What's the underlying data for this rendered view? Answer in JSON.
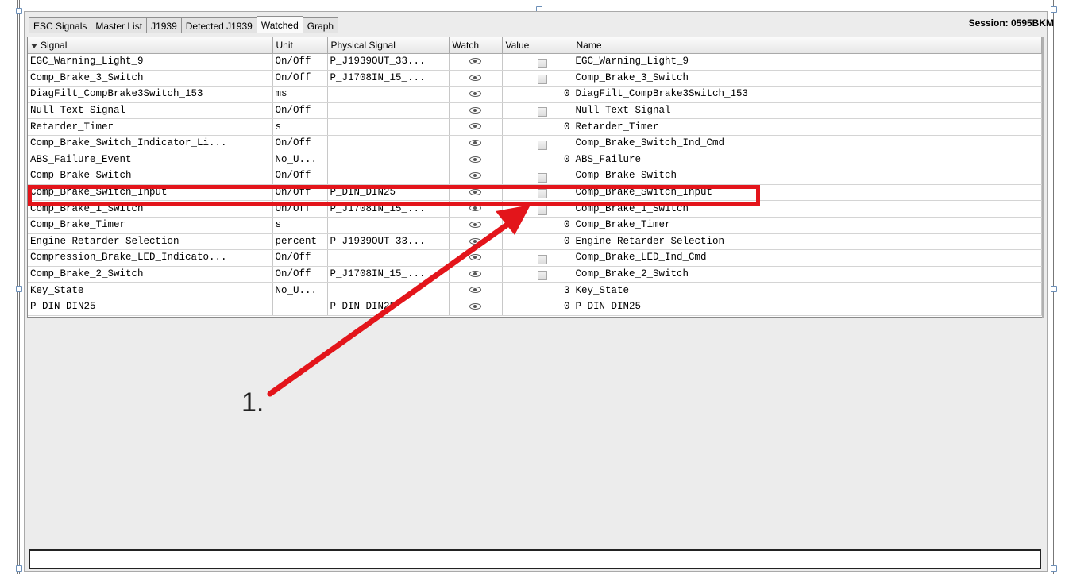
{
  "tabs": [
    {
      "label": "ESC Signals",
      "active": false
    },
    {
      "label": "Master List",
      "active": false
    },
    {
      "label": "J1939",
      "active": false
    },
    {
      "label": "Detected J1939",
      "active": false
    },
    {
      "label": "Watched",
      "active": true
    },
    {
      "label": "Graph",
      "active": false
    }
  ],
  "session_label": "Session: 0595BKM",
  "columns": [
    "Signal",
    "Unit",
    "Physical Signal",
    "Watch",
    "Value",
    "Name"
  ],
  "rows": [
    {
      "signal": "EGC_Warning_Light_9",
      "unit": "On/Off",
      "physical": "P_J1939OUT_33...",
      "value_type": "checkbox",
      "value": "",
      "name": "EGC_Warning_Light_9"
    },
    {
      "signal": "Comp_Brake_3_Switch",
      "unit": "On/Off",
      "physical": "P_J1708IN_15_...",
      "value_type": "checkbox",
      "value": "",
      "name": "Comp_Brake_3_Switch"
    },
    {
      "signal": "DiagFilt_CompBrake3Switch_153",
      "unit": "ms",
      "physical": "",
      "value_type": "number",
      "value": "0",
      "name": "DiagFilt_CompBrake3Switch_153"
    },
    {
      "signal": "Null_Text_Signal",
      "unit": "On/Off",
      "physical": "",
      "value_type": "checkbox",
      "value": "",
      "name": "Null_Text_Signal"
    },
    {
      "signal": "Retarder_Timer",
      "unit": "s",
      "physical": "",
      "value_type": "number",
      "value": "0",
      "name": "Retarder_Timer"
    },
    {
      "signal": "Comp_Brake_Switch_Indicator_Li...",
      "unit": "On/Off",
      "physical": "",
      "value_type": "checkbox",
      "value": "",
      "name": "Comp_Brake_Switch_Ind_Cmd"
    },
    {
      "signal": "ABS_Failure_Event",
      "unit": "No_U...",
      "physical": "",
      "value_type": "number",
      "value": "0",
      "name": "ABS_Failure"
    },
    {
      "signal": "Comp_Brake_Switch",
      "unit": "On/Off",
      "physical": "",
      "value_type": "checkbox",
      "value": "",
      "name": "Comp_Brake_Switch"
    },
    {
      "signal": "Comp_Brake_Switch_Input",
      "unit": "On/Off",
      "physical": "P_DIN_DIN25",
      "value_type": "checkbox",
      "value": "",
      "name": "Comp_Brake_Switch_Input"
    },
    {
      "signal": "Comp_Brake_1_Switch",
      "unit": "On/Off",
      "physical": "P_J1708IN_15_...",
      "value_type": "checkbox",
      "value": "",
      "name": "Comp_Brake_1_Switch"
    },
    {
      "signal": "Comp_Brake_Timer",
      "unit": "s",
      "physical": "",
      "value_type": "number",
      "value": "0",
      "name": "Comp_Brake_Timer"
    },
    {
      "signal": "Engine_Retarder_Selection",
      "unit": "percent",
      "physical": "P_J1939OUT_33...",
      "value_type": "number",
      "value": "0",
      "name": "Engine_Retarder_Selection"
    },
    {
      "signal": "Compression_Brake_LED_Indicato...",
      "unit": "On/Off",
      "physical": "",
      "value_type": "checkbox",
      "value": "",
      "name": "Comp_Brake_LED_Ind_Cmd"
    },
    {
      "signal": "Comp_Brake_2_Switch",
      "unit": "On/Off",
      "physical": "P_J1708IN_15_...",
      "value_type": "checkbox",
      "value": "",
      "name": "Comp_Brake_2_Switch"
    },
    {
      "signal": "Key_State",
      "unit": "No_U...",
      "physical": "",
      "value_type": "number",
      "value": "3",
      "name": "Key_State"
    },
    {
      "signal": "P_DIN_DIN25",
      "unit": "",
      "physical": "P_DIN_DIN25",
      "value_type": "number",
      "value": "0",
      "name": "P_DIN_DIN25"
    }
  ],
  "annotation": {
    "label": "1.",
    "color": "#e3151b"
  },
  "icons": {
    "watch": "eye-icon",
    "filter": "filter-icon"
  }
}
